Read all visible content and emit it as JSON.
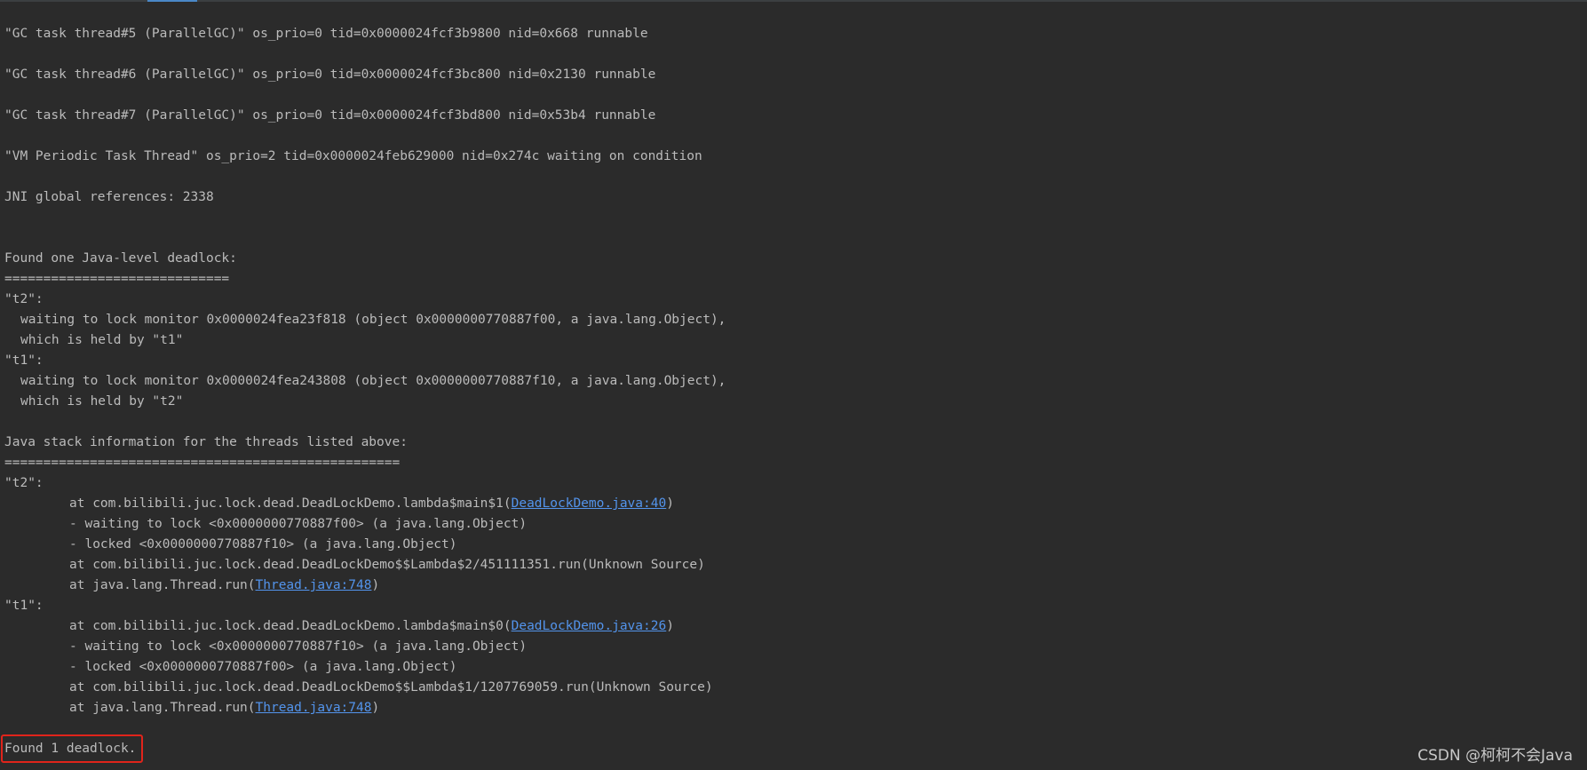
{
  "console": {
    "gc5": "\"GC task thread#5 (ParallelGC)\" os_prio=0 tid=0x0000024fcf3b9800 nid=0x668 runnable",
    "gc6": "\"GC task thread#6 (ParallelGC)\" os_prio=0 tid=0x0000024fcf3bc800 nid=0x2130 runnable",
    "gc7": "\"GC task thread#7 (ParallelGC)\" os_prio=0 tid=0x0000024fcf3bd800 nid=0x53b4 runnable",
    "vm_periodic": "\"VM Periodic Task Thread\" os_prio=2 tid=0x0000024feb629000 nid=0x274c waiting on condition",
    "jni": "JNI global references: 2338",
    "found_one": "Found one Java-level deadlock:",
    "sep1": "=============================",
    "t2_header": "\"t2\":",
    "t2_waiting": "waiting to lock monitor 0x0000024fea23f818 (object 0x0000000770887f00, a java.lang.Object),",
    "t2_held": "which is held by \"t1\"",
    "t1_header": "\"t1\":",
    "t1_waiting": "waiting to lock monitor 0x0000024fea243808 (object 0x0000000770887f10, a java.lang.Object),",
    "t1_held": "which is held by \"t2\"",
    "stack_info": "Java stack information for the threads listed above:",
    "sep2": "===================================================",
    "stack_t2_header": "\"t2\":",
    "stack_t2_line1_prefix": "at com.bilibili.juc.lock.dead.DeadLockDemo.lambda$main$1(",
    "stack_t2_line1_link": "DeadLockDemo.java:40",
    "stack_t2_line1_suffix": ")",
    "stack_t2_line2": "- waiting to lock <0x0000000770887f00> (a java.lang.Object)",
    "stack_t2_line3": "- locked <0x0000000770887f10> (a java.lang.Object)",
    "stack_t2_line4": "at com.bilibili.juc.lock.dead.DeadLockDemo$$Lambda$2/451111351.run(Unknown Source)",
    "stack_t2_line5_prefix": "at java.lang.Thread.run(",
    "stack_t2_line5_link": "Thread.java:748",
    "stack_t2_line5_suffix": ")",
    "stack_t1_header": "\"t1\":",
    "stack_t1_line1_prefix": "at com.bilibili.juc.lock.dead.DeadLockDemo.lambda$main$0(",
    "stack_t1_line1_link": "DeadLockDemo.java:26",
    "stack_t1_line1_suffix": ")",
    "stack_t1_line2": "- waiting to lock <0x0000000770887f10> (a java.lang.Object)",
    "stack_t1_line3": "- locked <0x0000000770887f00> (a java.lang.Object)",
    "stack_t1_line4": "at com.bilibili.juc.lock.dead.DeadLockDemo$$Lambda$1/1207769059.run(Unknown Source)",
    "stack_t1_line5_prefix": "at java.lang.Thread.run(",
    "stack_t1_line5_link": "Thread.java:748",
    "stack_t1_line5_suffix": ")",
    "found_1": "Found 1 deadlock."
  },
  "watermark": "CSDN @柯柯不会Java",
  "colors": {
    "background": "#2b2b2b",
    "text": "#bbbbbb",
    "link": "#5394ec",
    "highlight_box": "#e0241b"
  }
}
